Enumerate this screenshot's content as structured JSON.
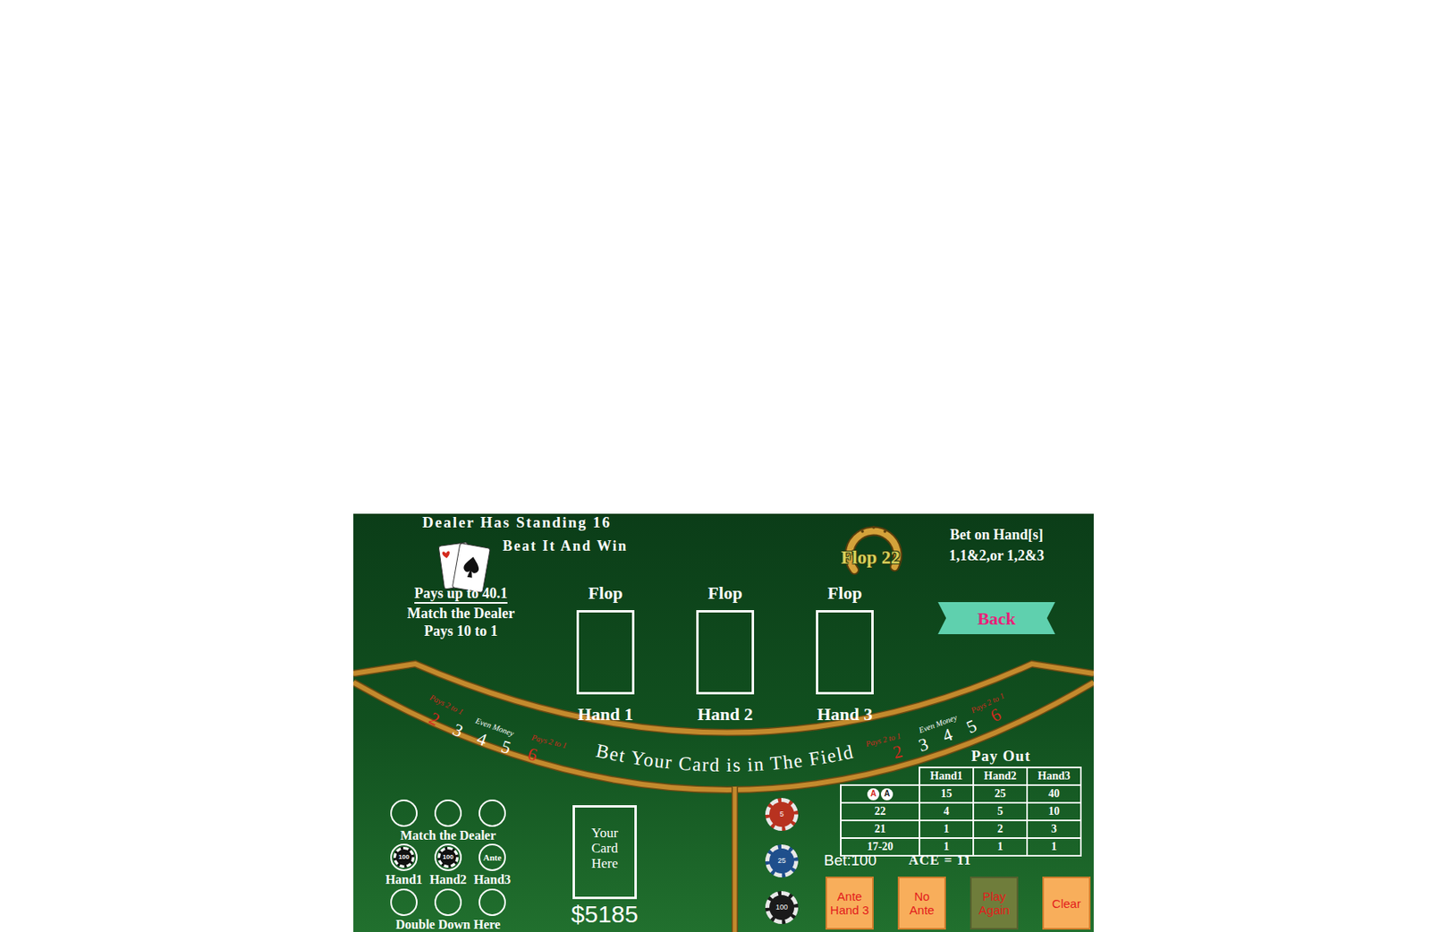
{
  "header": {
    "dealer": "Dealer Has Standing 16",
    "tagline": "Beat It And Win"
  },
  "promo": {
    "pays": "Pays up to 40.1",
    "match": "Match the Dealer",
    "match_pays": "Pays 10 to 1"
  },
  "logo": "Flop 22",
  "bet_hint": [
    "Bet on Hand[s]",
    "1,1&2,or 1,2&3"
  ],
  "back_button": "Back",
  "hands": [
    {
      "flop": "Flop",
      "label": "Hand 1"
    },
    {
      "flop": "Flop",
      "label": "Hand 2"
    },
    {
      "flop": "Flop",
      "label": "Hand 3"
    }
  ],
  "field": {
    "title": "Bet Your Card is in The Field",
    "left_numbers": [
      {
        "text": "2",
        "color": "#d42a1e"
      },
      {
        "text": "3",
        "color": "#ffffff"
      },
      {
        "text": "4",
        "color": "#ffffff"
      },
      {
        "text": "5",
        "color": "#ffffff"
      },
      {
        "text": "6",
        "color": "#d42a1e"
      }
    ],
    "right_numbers": [
      {
        "text": "2",
        "color": "#d42a1e"
      },
      {
        "text": "3",
        "color": "#ffffff"
      },
      {
        "text": "4",
        "color": "#ffffff"
      },
      {
        "text": "5",
        "color": "#ffffff"
      },
      {
        "text": "6",
        "color": "#d42a1e"
      }
    ],
    "left_labels": [
      {
        "text": "Pays 2 to 1",
        "color": "#d42a1e"
      },
      {
        "text": "Even Money",
        "color": "#ffffff"
      },
      {
        "text": "Pays 2 to 1",
        "color": "#d42a1e"
      }
    ],
    "right_labels": [
      {
        "text": "Pays 2 to 1",
        "color": "#d42a1e"
      },
      {
        "text": "Even Money",
        "color": "#ffffff"
      },
      {
        "text": "Pays 2 to 1",
        "color": "#d42a1e"
      }
    ]
  },
  "side_bets": {
    "match_label": "Match the Dealer",
    "match_spots": [
      {
        "filled": false
      },
      {
        "filled": false
      },
      {
        "filled": false
      }
    ],
    "hand_spots": [
      {
        "label": "Hand1",
        "chip": "100",
        "kind": "chip"
      },
      {
        "label": "Hand2",
        "chip": "100",
        "kind": "chip"
      },
      {
        "label": "Hand3",
        "chip": "Ante",
        "kind": "ante"
      }
    ],
    "double_label": "Double Down Here",
    "double_spots": [
      {
        "filled": false
      },
      {
        "filled": false
      },
      {
        "filled": false
      }
    ]
  },
  "your_card": [
    "Your",
    "Card",
    "Here"
  ],
  "balance": "$5185",
  "chips": [
    {
      "value": "5",
      "color": "#b8321f"
    },
    {
      "value": "25",
      "color": "#1f4f8c"
    },
    {
      "value": "100",
      "color": "#1a1a1a"
    }
  ],
  "payout": {
    "title": "Pay Out",
    "columns": [
      "Hand1",
      "Hand2",
      "Hand3"
    ],
    "rows": [
      {
        "label": "",
        "cards": [
          {
            "text": "A",
            "color": "#d42a1e"
          },
          {
            "text": "A",
            "color": "#1a1a1a"
          }
        ],
        "values": [
          "15",
          "25",
          "40"
        ]
      },
      {
        "label": "22",
        "cards": [],
        "values": [
          "4",
          "5",
          "10"
        ]
      },
      {
        "label": "21",
        "cards": [],
        "values": [
          "1",
          "2",
          "3"
        ]
      },
      {
        "label": "17-20",
        "cards": [],
        "values": [
          "1",
          "1",
          "1"
        ]
      }
    ],
    "note": "ACE = 11"
  },
  "bet": "Bet:100",
  "buttons": [
    {
      "label": "Ante Hand 3",
      "disabled": false
    },
    {
      "label": "No Ante",
      "disabled": false
    },
    {
      "label": "Play Again",
      "disabled": true
    },
    {
      "label": "Clear",
      "disabled": false
    }
  ]
}
